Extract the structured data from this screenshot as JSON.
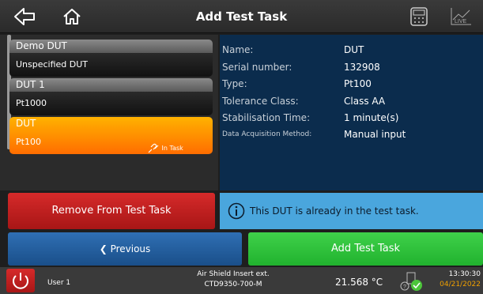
{
  "header": {
    "title": "Add Test Task",
    "icons": [
      "back-arrow-icon",
      "home-icon",
      "calculator-icon",
      "live-chart-icon"
    ],
    "live_label": "LIVE"
  },
  "dut_list": {
    "items": [
      {
        "name": "Demo DUT",
        "type": "Unspecified DUT",
        "selected": false
      },
      {
        "name": "DUT 1",
        "type": "Pt1000",
        "selected": false
      },
      {
        "name": "DUT",
        "type": "Pt100",
        "selected": true,
        "badge": "In Task"
      }
    ]
  },
  "details": {
    "rows": [
      {
        "label": "Name:",
        "value": "DUT"
      },
      {
        "label": "Serial number:",
        "value": "132908"
      },
      {
        "label": "Type:",
        "value": "Pt100"
      },
      {
        "label": "Tolerance Class:",
        "value": "Class AA"
      },
      {
        "label": "Stabilisation Time:",
        "value": "1 minute(s)"
      },
      {
        "label": "Data Acquisition Method:",
        "value": "Manual input"
      }
    ]
  },
  "actions": {
    "remove_label": "Remove From Test Task",
    "info_message": "This DUT is already in the test task.",
    "previous_label": "❮ Previous",
    "add_label": "Add Test Task"
  },
  "status_bar": {
    "user": "User 1",
    "device_line1": "Air Shield Insert ext.",
    "device_line2": "CTD9350-700-M",
    "temperature": "21.568 °C",
    "time": "13:30:30",
    "date": "04/21/2022"
  },
  "colors": {
    "header_bg": "#2f2f2f",
    "details_bg": "#0b2c4d",
    "selected_item": "#ff9800",
    "remove_button": "#c62828",
    "info_box": "#4aa6dd",
    "previous_button": "#2563a6",
    "add_button": "#2ec43a"
  }
}
